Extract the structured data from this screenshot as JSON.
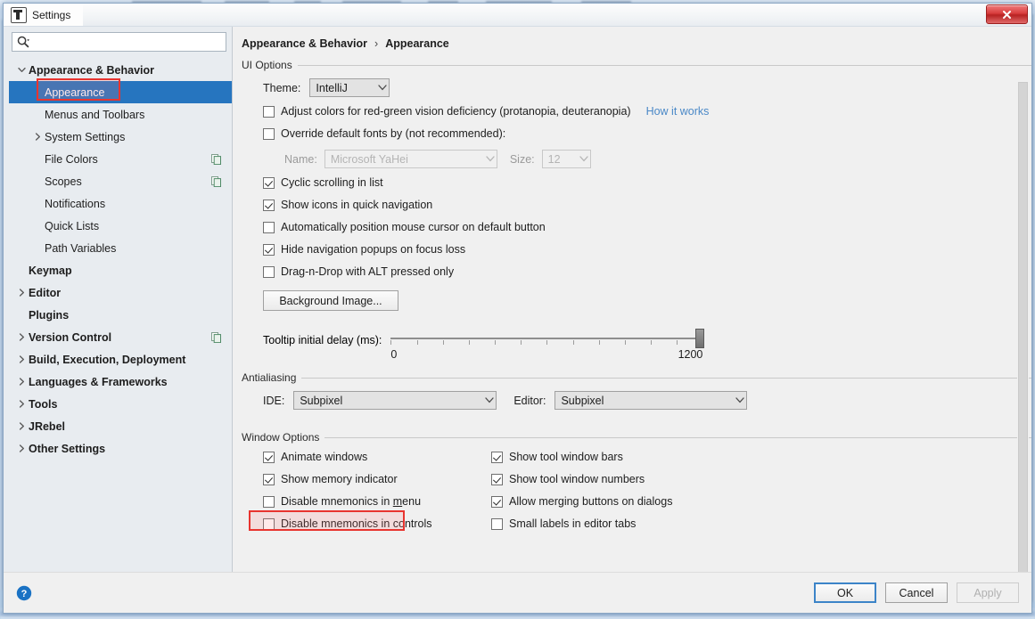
{
  "window": {
    "title": "Settings",
    "app_icon": "intellij-idea-icon",
    "close_label": "Close"
  },
  "search": {
    "placeholder": "",
    "value": "",
    "icon": "search-icon"
  },
  "sidebar": {
    "items": [
      {
        "label": "Appearance & Behavior",
        "level": 0,
        "bold": true,
        "twisty": "expanded",
        "selected": false,
        "copy_icon": false
      },
      {
        "label": "Appearance",
        "level": 1,
        "bold": false,
        "twisty": "none",
        "selected": true,
        "copy_icon": false
      },
      {
        "label": "Menus and Toolbars",
        "level": 1,
        "bold": false,
        "twisty": "none",
        "selected": false,
        "copy_icon": false
      },
      {
        "label": "System Settings",
        "level": 1,
        "bold": false,
        "twisty": "collapsed",
        "selected": false,
        "copy_icon": false
      },
      {
        "label": "File Colors",
        "level": 1,
        "bold": false,
        "twisty": "none",
        "selected": false,
        "copy_icon": true
      },
      {
        "label": "Scopes",
        "level": 1,
        "bold": false,
        "twisty": "none",
        "selected": false,
        "copy_icon": true
      },
      {
        "label": "Notifications",
        "level": 1,
        "bold": false,
        "twisty": "none",
        "selected": false,
        "copy_icon": false
      },
      {
        "label": "Quick Lists",
        "level": 1,
        "bold": false,
        "twisty": "none",
        "selected": false,
        "copy_icon": false
      },
      {
        "label": "Path Variables",
        "level": 1,
        "bold": false,
        "twisty": "none",
        "selected": false,
        "copy_icon": false
      },
      {
        "label": "Keymap",
        "level": 0,
        "bold": true,
        "twisty": "none",
        "selected": false,
        "copy_icon": false
      },
      {
        "label": "Editor",
        "level": 0,
        "bold": true,
        "twisty": "collapsed",
        "selected": false,
        "copy_icon": false
      },
      {
        "label": "Plugins",
        "level": 0,
        "bold": true,
        "twisty": "none",
        "selected": false,
        "copy_icon": false
      },
      {
        "label": "Version Control",
        "level": 0,
        "bold": true,
        "twisty": "collapsed",
        "selected": false,
        "copy_icon": true
      },
      {
        "label": "Build, Execution, Deployment",
        "level": 0,
        "bold": true,
        "twisty": "collapsed",
        "selected": false,
        "copy_icon": false
      },
      {
        "label": "Languages & Frameworks",
        "level": 0,
        "bold": true,
        "twisty": "collapsed",
        "selected": false,
        "copy_icon": false
      },
      {
        "label": "Tools",
        "level": 0,
        "bold": true,
        "twisty": "collapsed",
        "selected": false,
        "copy_icon": false
      },
      {
        "label": "JRebel",
        "level": 0,
        "bold": true,
        "twisty": "collapsed",
        "selected": false,
        "copy_icon": false
      },
      {
        "label": "Other Settings",
        "level": 0,
        "bold": true,
        "twisty": "collapsed",
        "selected": false,
        "copy_icon": false
      }
    ]
  },
  "breadcrumb": {
    "root": "Appearance & Behavior",
    "separator": "›",
    "current": "Appearance"
  },
  "ui_options": {
    "group_title": "UI Options",
    "theme_label": "Theme:",
    "theme_value": "IntelliJ",
    "adjust_colors_label": "Adjust colors for red-green vision deficiency (protanopia, deuteranopia)",
    "adjust_colors_checked": false,
    "how_it_works_label": "How it works",
    "override_fonts_label": "Override default fonts by (not recommended):",
    "override_fonts_checked": false,
    "name_label": "Name:",
    "name_value": "Microsoft YaHei",
    "size_label": "Size:",
    "size_value": "12",
    "fonts_disabled": true,
    "checkboxes": [
      {
        "label": "Cyclic scrolling in list",
        "checked": true
      },
      {
        "label": "Show icons in quick navigation",
        "checked": true
      },
      {
        "label": "Automatically position mouse cursor on default button",
        "checked": false
      },
      {
        "label": "Hide navigation popups on focus loss",
        "checked": true
      },
      {
        "label": "Drag-n-Drop with ALT pressed only",
        "checked": false
      }
    ],
    "background_image_label": "Background Image...",
    "tooltip_delay_label": "Tooltip initial delay (ms):",
    "tooltip_delay_min": "0",
    "tooltip_delay_max": "1200",
    "tooltip_delay_value": 1200,
    "tooltip_tick_count": 13
  },
  "antialiasing": {
    "group_title": "Antialiasing",
    "ide_label": "IDE:",
    "ide_value": "Subpixel",
    "editor_label": "Editor:",
    "editor_value": "Subpixel"
  },
  "window_options": {
    "group_title": "Window Options",
    "left_column": [
      {
        "label": "Animate windows",
        "checked": true,
        "mnemonic": "",
        "highlighted": false
      },
      {
        "label": "Show memory indicator",
        "checked": true,
        "mnemonic": "",
        "highlighted": true
      },
      {
        "label": "Disable mnemonics in menu",
        "checked": false,
        "mnemonic": "m",
        "highlighted": false
      },
      {
        "label": "Disable mnemonics in controls",
        "checked": false,
        "mnemonic": "",
        "highlighted": false
      }
    ],
    "right_column": [
      {
        "label": "Show tool window bars",
        "checked": true
      },
      {
        "label": "Show tool window numbers",
        "checked": true
      },
      {
        "label": "Allow merging buttons on dialogs",
        "checked": true
      },
      {
        "label": "Small labels in editor tabs",
        "checked": false
      }
    ]
  },
  "footer": {
    "help_icon": "help-icon",
    "ok_label": "OK",
    "cancel_label": "Cancel",
    "apply_label": "Apply",
    "apply_disabled": true
  },
  "colors": {
    "selection_blue": "#2675bf",
    "link_blue": "#4a88c7",
    "annotation_red": "#e8342f",
    "dialog_bg": "#f0f0f0",
    "sidebar_bg": "#e8ecf0"
  }
}
